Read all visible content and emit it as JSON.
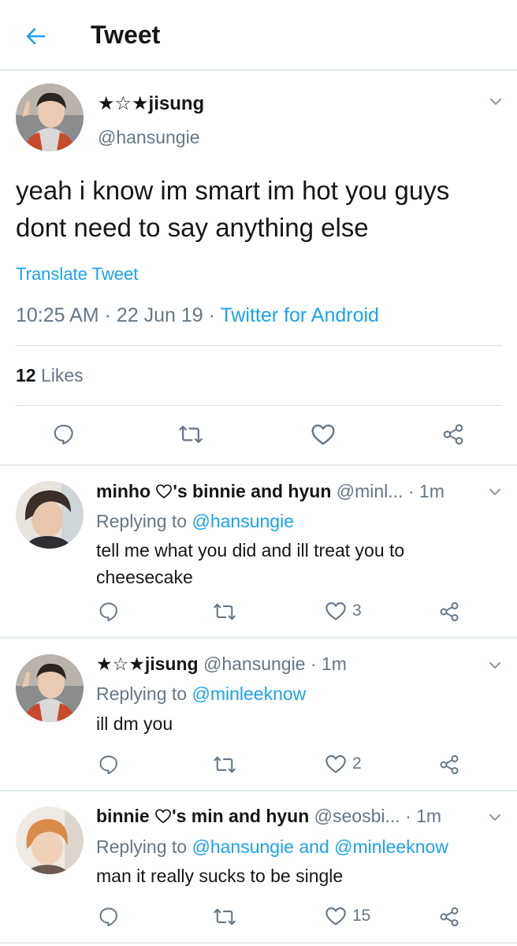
{
  "header": {
    "title": "Tweet"
  },
  "main_tweet": {
    "display_name": "★☆★jisung",
    "handle": "@hansungie",
    "text": "yeah i know im smart im hot you guys dont need to say anything else",
    "translate_label": "Translate Tweet",
    "time": "10:25 AM",
    "date": "22 Jun 19",
    "client": "Twitter for Android",
    "likes_count": "12",
    "likes_label": "Likes"
  },
  "replies": [
    {
      "name_prefix": "minho",
      "name_suffix": "'s binnie and hyun",
      "handle": "@minl...",
      "time": "1m",
      "replying_label": "Replying to",
      "replying_to": "@hansungie",
      "text": "tell me what you did and ill treat you to cheesecake",
      "like_count": "3"
    },
    {
      "name": "★☆★jisung",
      "handle": "@hansungie",
      "time": "1m",
      "replying_label": "Replying to",
      "replying_to": "@minleeknow",
      "text": "ill dm you",
      "like_count": "2"
    },
    {
      "name_prefix": "binnie",
      "name_suffix": "'s min and hyun",
      "handle": "@seosbi...",
      "time": "1m",
      "replying_label": "Replying to",
      "replying_to": "@hansungie and @minleeknow",
      "text": "man it really sucks to be single",
      "like_count": "15"
    }
  ],
  "colors": {
    "accent": "#1da1f2",
    "secondary_text": "#657786",
    "divider": "#e1e8ed"
  },
  "icons": [
    "back-arrow-icon",
    "chevron-down-icon",
    "reply-icon",
    "retweet-icon",
    "heart-icon",
    "share-icon"
  ]
}
